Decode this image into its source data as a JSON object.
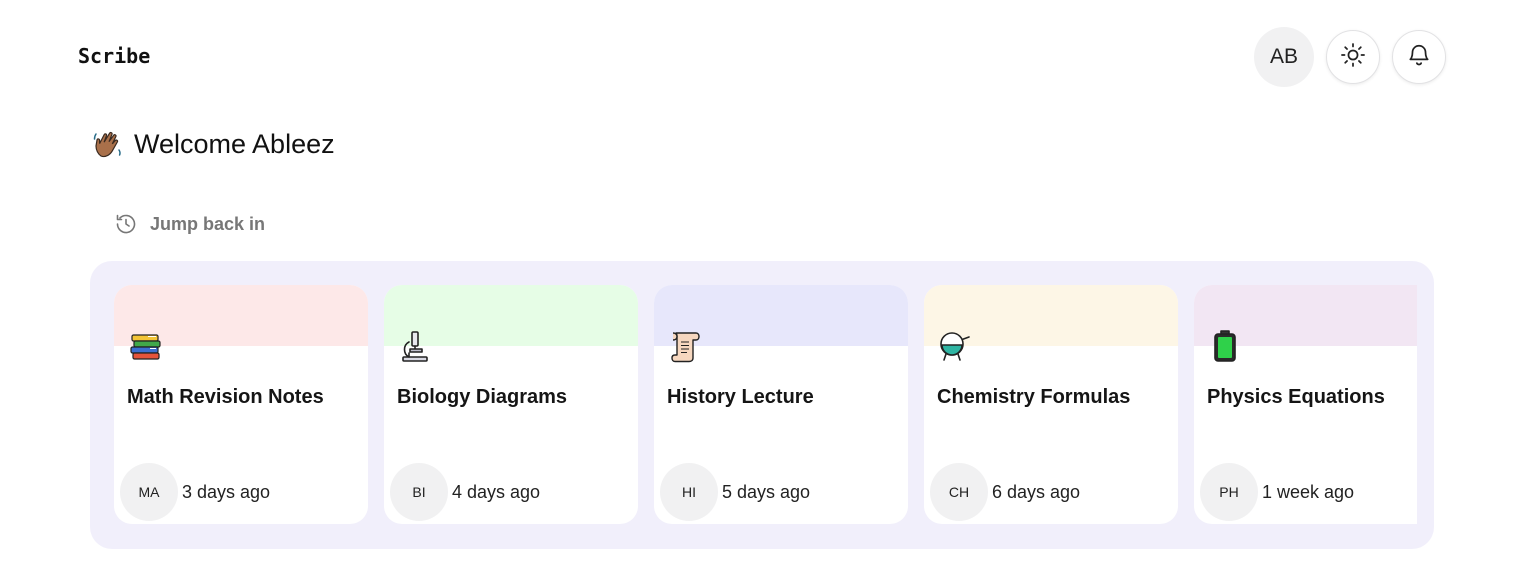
{
  "app": {
    "brand": "Scribe"
  },
  "header": {
    "avatar_initials": "AB",
    "theme_icon": "sun-icon",
    "notifications_icon": "bell-icon"
  },
  "welcome": {
    "text": "Welcome Ableez",
    "icon": "waving-hand-icon"
  },
  "section": {
    "label": "Jump back in",
    "icon": "history-icon"
  },
  "colors": {
    "panel_bg": "#f1effb",
    "banners": [
      "#fde8e8",
      "#e6fde6",
      "#e7e7fb",
      "#fdf6e6",
      "#f2e6f3"
    ]
  },
  "cards": [
    {
      "title": "Math Revision Notes",
      "initials": "MA",
      "time": "3 days ago",
      "icon": "books-icon",
      "banner": "#fde8e8"
    },
    {
      "title": "Biology Diagrams",
      "initials": "BI",
      "time": "4 days ago",
      "icon": "microscope-icon",
      "banner": "#e6fde6"
    },
    {
      "title": "History Lecture",
      "initials": "HI",
      "time": "5 days ago",
      "icon": "scroll-icon",
      "banner": "#e7e7fb"
    },
    {
      "title": "Chemistry Formulas",
      "initials": "CH",
      "time": "6 days ago",
      "icon": "flask-icon",
      "banner": "#fdf6e6"
    },
    {
      "title": "Physics Equations",
      "initials": "PH",
      "time": "1 week ago",
      "icon": "battery-icon",
      "banner": "#f2e6f3"
    }
  ]
}
